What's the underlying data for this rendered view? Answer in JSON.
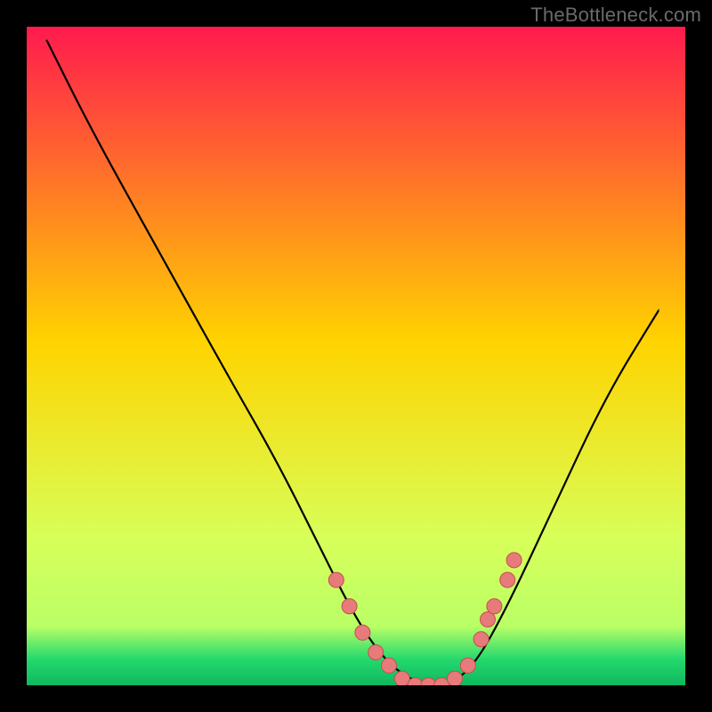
{
  "watermark": "TheBottleneck.com",
  "colors": {
    "bg": "#000000",
    "curve": "#000000",
    "dot_fill": "#e77a7a",
    "dot_stroke": "#c54f4f",
    "grad_top": "#ff1a4e",
    "grad_mid": "#ffd400",
    "grad_low": "#d7ff5a",
    "grad_green": "#25d96d",
    "grad_bottom": "#0fb85f"
  },
  "chart_data": {
    "type": "line",
    "title": "",
    "xlabel": "",
    "ylabel": "",
    "xlim": [
      0,
      100
    ],
    "ylim": [
      0,
      100
    ],
    "note": "Bottleneck-style V curve. X is an implicit component axis (0–100, no ticks shown). Y is bottleneck percentage (0–100, 0 at bottom where the green band is). No axis ticks or labels are rendered.",
    "series": [
      {
        "name": "curve",
        "x": [
          3,
          10,
          20,
          30,
          38,
          44,
          50,
          55,
          60,
          64,
          68,
          73,
          80,
          88,
          96
        ],
        "values": [
          98,
          84,
          66,
          48,
          34,
          22,
          10,
          3,
          0,
          0,
          3,
          12,
          27,
          44,
          57
        ]
      },
      {
        "name": "dots",
        "x": [
          47,
          49,
          51,
          53,
          55,
          57,
          59,
          61,
          63,
          65,
          67,
          69,
          70,
          71,
          73,
          74
        ],
        "values": [
          16,
          12,
          8,
          5,
          3,
          1,
          0,
          0,
          0,
          1,
          3,
          7,
          10,
          12,
          16,
          19
        ]
      }
    ]
  }
}
